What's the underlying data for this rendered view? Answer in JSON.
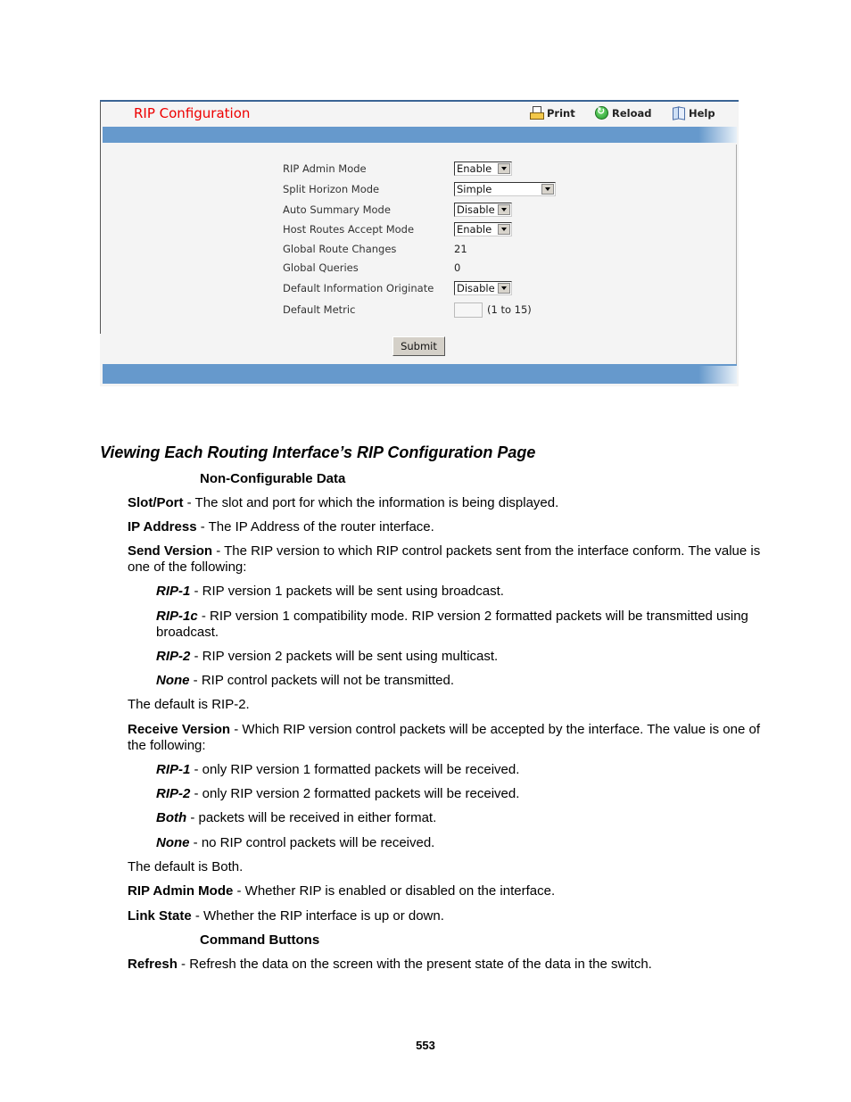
{
  "screenshot": {
    "title": "RIP Configuration",
    "toolbar": {
      "print": "Print",
      "reload": "Reload",
      "help": "Help"
    },
    "fields": [
      {
        "label": "RIP Admin Mode",
        "type": "select",
        "value": "Enable"
      },
      {
        "label": "Split Horizon Mode",
        "type": "select",
        "value": "Simple"
      },
      {
        "label": "Auto Summary Mode",
        "type": "select",
        "value": "Disable"
      },
      {
        "label": "Host Routes Accept Mode",
        "type": "select",
        "value": "Enable"
      },
      {
        "label": "Global Route Changes",
        "type": "text",
        "value": "21"
      },
      {
        "label": "Global Queries",
        "type": "text",
        "value": "0"
      },
      {
        "label": "Default Information Originate",
        "type": "select",
        "value": "Disable"
      },
      {
        "label": "Default Metric",
        "type": "input",
        "value": "",
        "hint": "(1 to 15)"
      }
    ],
    "submit_label": "Submit"
  },
  "document": {
    "heading": "Viewing Each Routing Interface’s RIP Configuration Page",
    "non_configurable_heading": "Non-Configurable Data",
    "slot_port": {
      "term": "Slot/Port",
      "text": " - The slot and port for which the information is being displayed."
    },
    "ip_address": {
      "term": "IP Address",
      "text": " - The IP Address of the router interface."
    },
    "send_version": {
      "term": "Send Version",
      "text": " - The RIP version to which RIP control packets sent from the interface conform. The value is one of the following:"
    },
    "send_options": [
      {
        "term": "RIP-1",
        "text": " - RIP version 1 packets will be sent using broadcast."
      },
      {
        "term": "RIP-1c",
        "text": " - RIP version 1 compatibility mode. RIP version 2 formatted packets will be transmitted using broadcast."
      },
      {
        "term": "RIP-2",
        "text": " - RIP version 2 packets will be sent using multicast."
      },
      {
        "term": "None",
        "text": " - RIP control packets will not be transmitted."
      }
    ],
    "send_default": "The default is RIP-2.",
    "receive_version": {
      "term": "Receive Version",
      "text": " - Which RIP version control packets will be accepted by the interface. The value is one of the following:"
    },
    "receive_options": [
      {
        "term": "RIP-1",
        "text": " - only RIP version 1 formatted packets will be received."
      },
      {
        "term": "RIP-2",
        "text": " - only RIP version 2 formatted packets will be received."
      },
      {
        "term": "Both",
        "text": " - packets will be received in either format."
      },
      {
        "term": "None",
        "text": " - no RIP control packets will be received."
      }
    ],
    "receive_default": "The default is Both.",
    "rip_admin_mode": {
      "term": "RIP Admin Mode",
      "text": " - Whether RIP is enabled or disabled on the interface."
    },
    "link_state": {
      "term": "Link State",
      "text": " - Whether the RIP interface is up or down."
    },
    "command_buttons_heading": "Command Buttons",
    "refresh": {
      "term": "Refresh",
      "text": " - Refresh the data on the screen with the present state of the data in the switch."
    }
  },
  "page_number": "553"
}
